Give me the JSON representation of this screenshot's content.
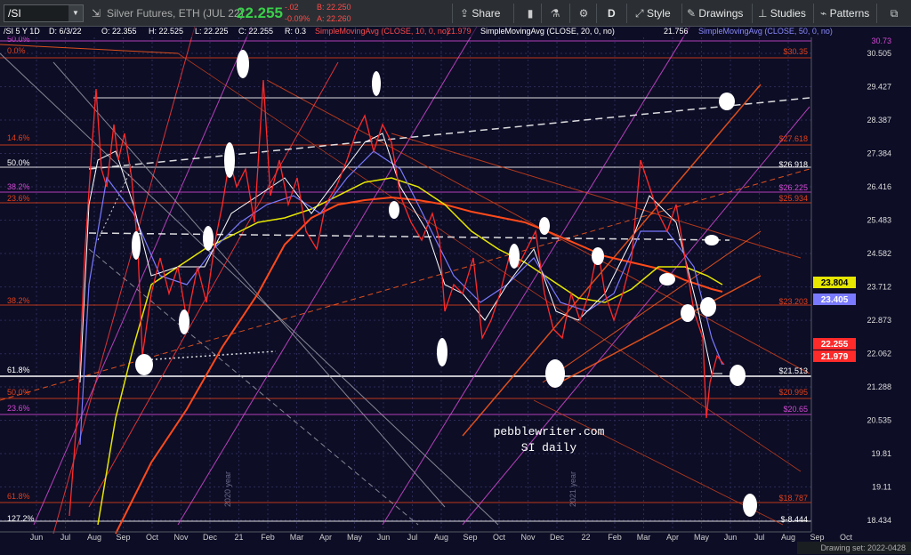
{
  "toolbar": {
    "symbol": "/SI",
    "description": "Silver Futures, ETH (JUL 22)",
    "last_price": "22.255",
    "change": "-.02",
    "change_pct": "-0.09%",
    "bid": "B: 22.250",
    "ask": "A: 22.260",
    "share_label": "Share",
    "interval_label": "D",
    "style_label": "Style",
    "drawings_label": "Drawings",
    "studies_label": "Studies",
    "patterns_label": "Patterns",
    "icons": [
      "symbol-dropdown-icon",
      "share-icon",
      "bookmark-icon",
      "flask-icon",
      "gear-icon",
      "style-icon",
      "drawings-icon",
      "studies-icon",
      "patterns-icon"
    ]
  },
  "header": {
    "chart_info": "/SI 5 Y 1D",
    "date": "D: 6/3/22",
    "open": "O: 22.355",
    "high": "H: 22.525",
    "low": "L: 22.225",
    "close": "C: 22.255",
    "range": "R: 0.3",
    "sma10_label": "SimpleMovingAvg (CLOSE, 10, 0, no)",
    "sma10_value": "21.979",
    "sma20_label": "SimpleMovingAvg (CLOSE, 20, 0, no)",
    "sma20_value": "21.756",
    "sma50_label": "SimpleMovingAvg (CLOSE, 50, 0, no)",
    "sma50_value": "30.73"
  },
  "colors": {
    "background": "#0d0d26",
    "price_line": "#ff2a2a",
    "sma10": "#ffffff",
    "sma20": "#7a7aff",
    "sma50": "#e6e600",
    "sma_long": "#ff4a1a",
    "fib_red": "#e0401a",
    "fib_magenta": "#d24ad2",
    "channel_orange": "#ff5a1a",
    "watermark": "#ffffff"
  },
  "chart_data": {
    "type": "line",
    "title": "",
    "xlabel": "",
    "ylabel": "",
    "x_ticks": [
      "Jun",
      "Jul",
      "Aug",
      "Sep",
      "Oct",
      "Nov",
      "Dec",
      "21",
      "Feb",
      "Mar",
      "Apr",
      "May",
      "Jun",
      "Jul",
      "Aug",
      "Sep",
      "Oct",
      "Nov",
      "Dec",
      "22",
      "Feb",
      "Mar",
      "Apr",
      "May",
      "Jun",
      "Jul",
      "Aug",
      "Sep",
      "Oct"
    ],
    "y_ticks": [
      "30.505",
      "29.427",
      "28.387",
      "27.384",
      "26.416",
      "25.483",
      "24.582",
      "23.712",
      "22.873",
      "22.062",
      "21.288",
      "20.535",
      "19.81",
      "19.11",
      "18.434"
    ],
    "ylim": [
      18.434,
      30.505
    ],
    "series": [
      {
        "name": "SimpleMovingAvg (CLOSE, 10, 0, no)",
        "last": 21.979
      },
      {
        "name": "SimpleMovingAvg (CLOSE, 20, 0, no)",
        "last": 21.756
      },
      {
        "name": "SimpleMovingAvg (CLOSE, 50, 0, no)"
      }
    ],
    "price_boxes": [
      {
        "value": "23.804",
        "bg": "#e6e600",
        "fg": "#000000"
      },
      {
        "value": "23.405",
        "bg": "#7a7aff",
        "fg": "#ffffff"
      },
      {
        "value": "22.255",
        "bg": "#ff2a2a",
        "fg": "#ffffff"
      },
      {
        "value": "21.979",
        "bg": "#ff2a2a",
        "fg": "#ffffff"
      }
    ],
    "fib_left": [
      {
        "label": "50.0%",
        "color": "#d24ad2"
      },
      {
        "label": "0.0%",
        "color": "#e0401a"
      },
      {
        "label": "14.6%",
        "color": "#e0401a"
      },
      {
        "label": "50.0%",
        "color": "#ffffff"
      },
      {
        "label": "38.2%",
        "color": "#d24ad2"
      },
      {
        "label": "23.6%",
        "color": "#e0401a"
      },
      {
        "label": "38.2%",
        "color": "#e0401a"
      },
      {
        "label": "61.8%",
        "color": "#ffffff"
      },
      {
        "label": "50.0%",
        "color": "#e0401a"
      },
      {
        "label": "23.6%",
        "color": "#d24ad2"
      },
      {
        "label": "61.8%",
        "color": "#e0401a"
      },
      {
        "label": "127.2%",
        "color": "#ffffff"
      }
    ],
    "fib_right": [
      {
        "label": "$30.35",
        "color": "#e0401a"
      },
      {
        "label": "$27.618",
        "color": "#e0401a"
      },
      {
        "label": "$26.918",
        "color": "#ffffff"
      },
      {
        "label": "$26.225",
        "color": "#d24ad2"
      },
      {
        "label": "$25.934",
        "color": "#e0401a"
      },
      {
        "label": "$23.203",
        "color": "#e0401a"
      },
      {
        "label": "$21.513",
        "color": "#ffffff"
      },
      {
        "label": "$20.995",
        "color": "#e0401a"
      },
      {
        "label": "$20.65",
        "color": "#d24ad2"
      },
      {
        "label": "$18.787",
        "color": "#e0401a"
      },
      {
        "label": "$-8.444",
        "color": "#ffffff"
      }
    ],
    "year_labels": [
      "2020 year",
      "2021 year"
    ],
    "watermark_line1": "pebblewriter.com",
    "watermark_line2": "SI daily",
    "drawing_set": "Drawing set: 2022-0428"
  }
}
